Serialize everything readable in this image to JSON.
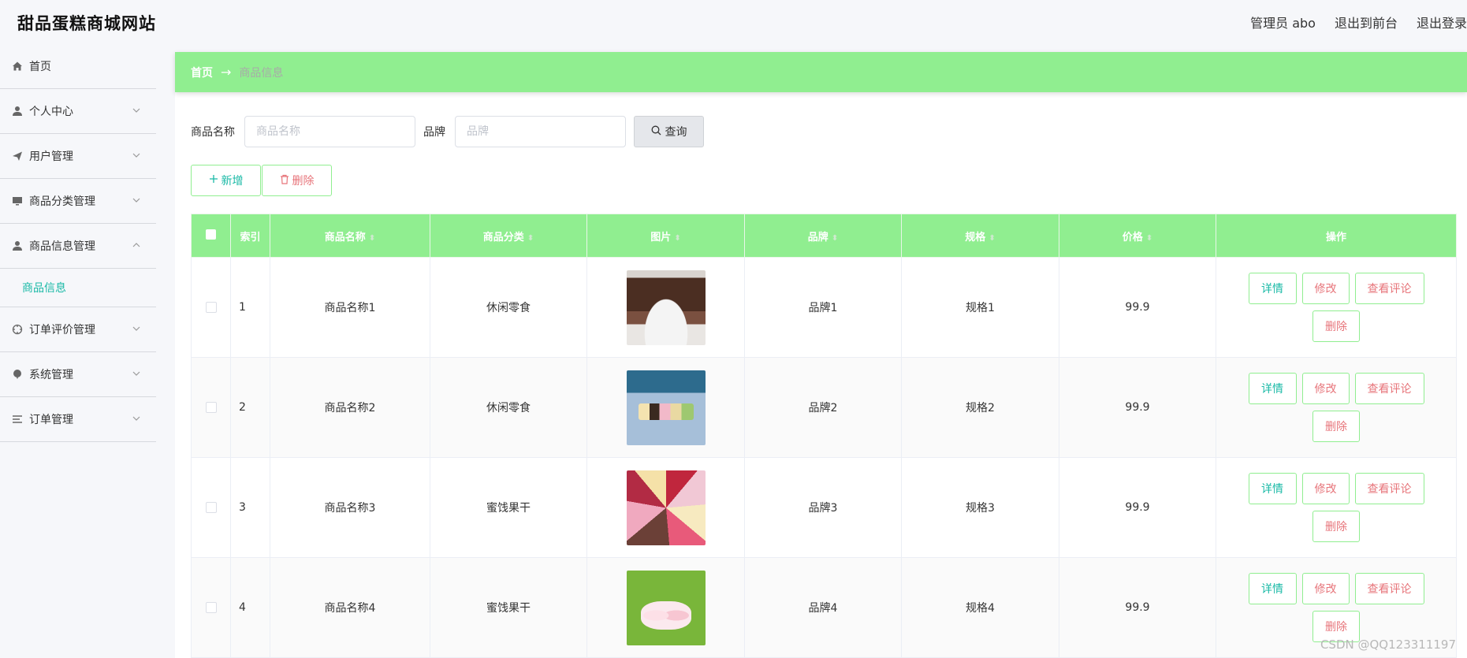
{
  "header": {
    "site_title": "甜品蛋糕商城网站",
    "admin_label": "管理员 abo",
    "back_to_front": "退出到前台",
    "logout": "退出登录"
  },
  "sidebar": {
    "items": [
      {
        "label": "首页",
        "icon": "home-icon"
      },
      {
        "label": "个人中心",
        "icon": "user-icon"
      },
      {
        "label": "用户管理",
        "icon": "paper-plane-icon"
      },
      {
        "label": "商品分类管理",
        "icon": "monitor-icon"
      },
      {
        "label": "商品信息管理",
        "icon": "user-icon"
      },
      {
        "label": "订单评价管理",
        "icon": "crosshair-icon"
      },
      {
        "label": "系统管理",
        "icon": "balloon-icon"
      },
      {
        "label": "订单管理",
        "icon": "list-icon"
      }
    ],
    "submenu": {
      "label": "商品信息"
    }
  },
  "breadcrumb": {
    "home": "首页",
    "arrow": "→",
    "current": "商品信息"
  },
  "search": {
    "name_label": "商品名称",
    "name_placeholder": "商品名称",
    "brand_label": "品牌",
    "brand_placeholder": "品牌",
    "query_label": "查询"
  },
  "actions": {
    "add_label": "新增",
    "delete_label": "删除"
  },
  "table": {
    "headers": {
      "index": "索引",
      "name": "商品名称",
      "category": "商品分类",
      "image": "图片",
      "brand": "品牌",
      "spec": "规格",
      "price": "价格",
      "ops": "操作"
    },
    "rows": [
      {
        "index": "1",
        "name": "商品名称1",
        "category": "休闲零食",
        "brand": "品牌1",
        "spec": "规格1",
        "price": "99.9"
      },
      {
        "index": "2",
        "name": "商品名称2",
        "category": "休闲零食",
        "brand": "品牌2",
        "spec": "规格2",
        "price": "99.9"
      },
      {
        "index": "3",
        "name": "商品名称3",
        "category": "蜜饯果干",
        "brand": "品牌3",
        "spec": "规格3",
        "price": "99.9"
      },
      {
        "index": "4",
        "name": "商品名称4",
        "category": "蜜饯果干",
        "brand": "品牌4",
        "spec": "规格4",
        "price": "99.9"
      }
    ],
    "op_labels": {
      "detail": "详情",
      "edit": "修改",
      "review": "查看评论",
      "delete": "删除"
    }
  },
  "watermark": "CSDN @QQ123311197",
  "colors": {
    "accent": "#90ee90",
    "teal": "#19b9a6",
    "danger": "#e7747a"
  }
}
